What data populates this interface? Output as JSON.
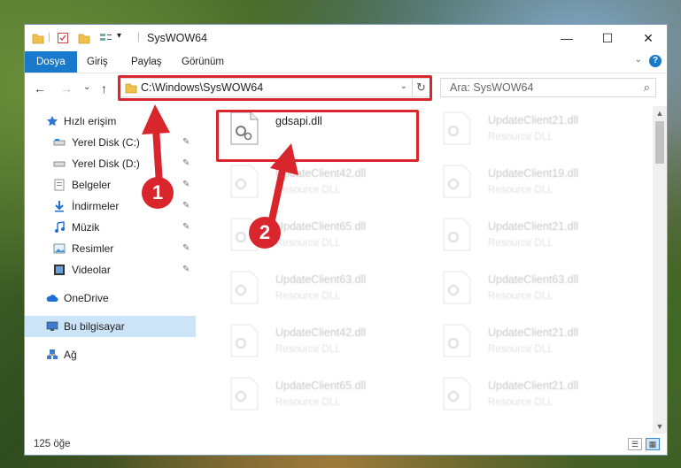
{
  "window": {
    "title": "SysWOW64",
    "controls": {
      "minimize": "—",
      "maximize": "☐",
      "close": "✕"
    }
  },
  "ribbon": {
    "tabs": [
      "Dosya",
      "Giriş",
      "Paylaş",
      "Görünüm"
    ],
    "help": "?"
  },
  "nav": {
    "back": "←",
    "forward": "→",
    "recent": "⌄",
    "up": "↑",
    "address": "C:\\Windows\\SysWOW64",
    "refresh": "↻",
    "search_placeholder": "Ara: SysWOW64",
    "search_icon": "⌕"
  },
  "sidebar": {
    "quick_access": "Hızlı erişim",
    "items": [
      {
        "label": "Yerel Disk (C:)",
        "icon": "drive-icon",
        "pinned": true
      },
      {
        "label": "Yerel Disk (D:)",
        "icon": "drive-icon",
        "pinned": true
      },
      {
        "label": "Belgeler",
        "icon": "documents-icon",
        "pinned": true
      },
      {
        "label": "İndirmeler",
        "icon": "download-icon",
        "pinned": true
      },
      {
        "label": "Müzik",
        "icon": "music-icon",
        "pinned": true
      },
      {
        "label": "Resimler",
        "icon": "pictures-icon",
        "pinned": true
      },
      {
        "label": "Videolar",
        "icon": "videos-icon",
        "pinned": true
      }
    ],
    "onedrive": "OneDrive",
    "this_pc": "Bu bilgisayar",
    "network": "Ağ",
    "pin_glyph": "📌"
  },
  "files": {
    "highlighted": {
      "name": "gdsapi.dll"
    },
    "col1": [
      {
        "name": "UpdateClient42.dll",
        "type": "Resource DLL"
      },
      {
        "name": "UpdateClient65.dll",
        "type": "Resource DLL"
      },
      {
        "name": "UpdateClient63.dll",
        "type": "Resource DLL"
      },
      {
        "name": "UpdateClient42.dll",
        "type": "Resource DLL"
      },
      {
        "name": "UpdateClient65.dll",
        "type": "Resource DLL"
      }
    ],
    "col2": [
      {
        "name": "UpdateClient21.dll",
        "type": "Resource DLL"
      },
      {
        "name": "UpdateClient19.dll",
        "type": "Resource DLL"
      },
      {
        "name": "UpdateClient21.dll",
        "type": "Resource DLL"
      },
      {
        "name": "UpdateClient63.dll",
        "type": "Resource DLL"
      },
      {
        "name": "UpdateClient21.dll",
        "type": "Resource DLL"
      },
      {
        "name": "UpdateClient21.dll",
        "type": "Resource DLL"
      }
    ]
  },
  "status": {
    "count": "125 öğe"
  },
  "annotations": {
    "step1": "1",
    "step2": "2",
    "color": "#d9262c"
  }
}
